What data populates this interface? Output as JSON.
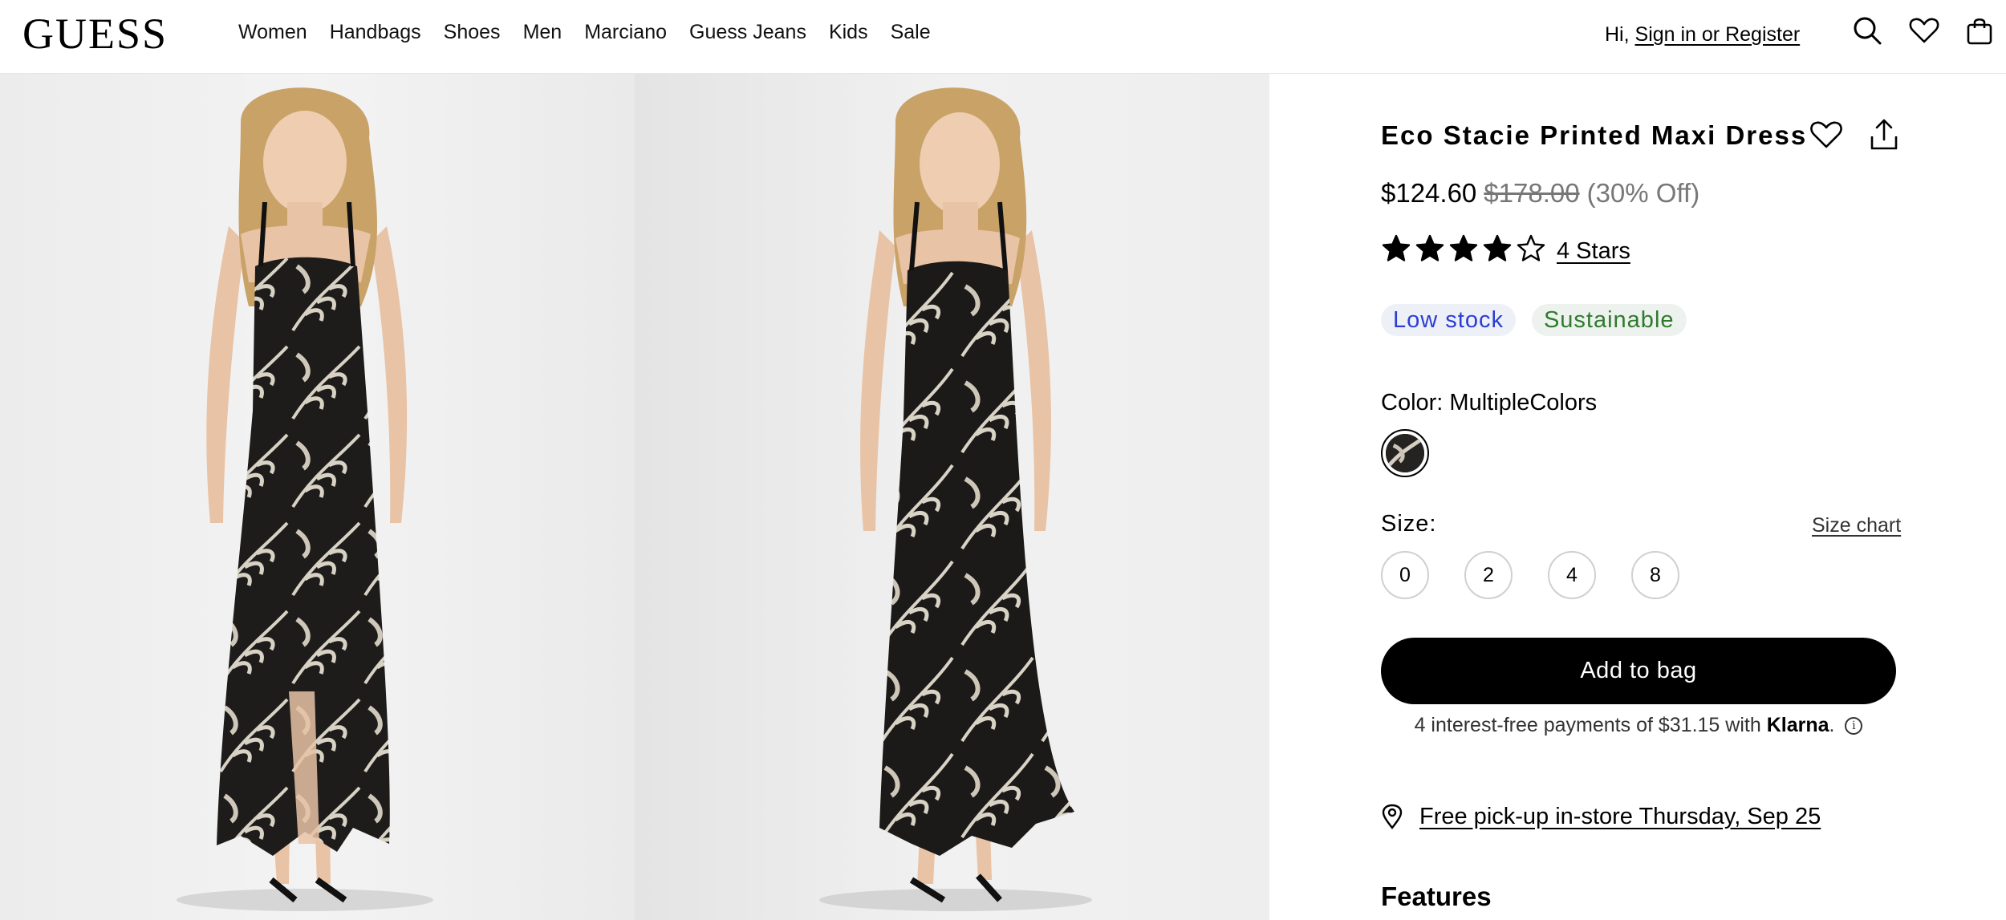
{
  "header": {
    "logo": "GUESS",
    "nav": [
      "Women",
      "Handbags",
      "Shoes",
      "Men",
      "Marciano",
      "Guess Jeans",
      "Kids",
      "Sale"
    ],
    "greeting_prefix": "Hi,",
    "sign_in_link": "Sign in or Register",
    "icons": [
      "search-icon",
      "heart-icon",
      "bag-icon"
    ]
  },
  "product": {
    "title": "Eco Stacie Printed Maxi Dress",
    "price_sale": "$124.60",
    "price_original": "$178.00",
    "price_discount": "(30% Off)",
    "rating": 4,
    "rating_max": 5,
    "rating_link": "4 Stars",
    "badges": {
      "stock": "Low stock",
      "sustainable": "Sustainable"
    },
    "color_label": "Color: MultipleColors",
    "size_label": "Size:",
    "size_chart_link": "Size chart",
    "sizes": [
      "0",
      "2",
      "4",
      "8"
    ],
    "add_to_bag": "Add to bag",
    "klarna_text": "4 interest-free payments of $31.15 with",
    "klarna_brand": "Klarna",
    "klarna_suffix": ".",
    "pickup_text": "Free pick-up in-store Thursday, Sep 25",
    "features_heading": "Features"
  },
  "colors": {
    "accent": "#000000",
    "low_stock": "#2b3ed1",
    "sustainable": "#2f7a2f",
    "muted_price": "#777777"
  }
}
